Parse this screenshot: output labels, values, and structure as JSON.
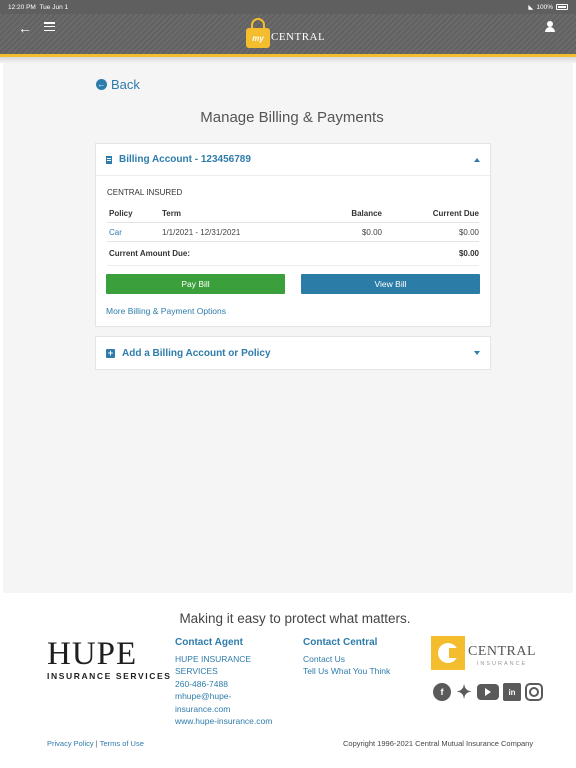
{
  "status_bar": {
    "time": "12:20 PM",
    "date": "Tue Jun 1",
    "battery": "100%"
  },
  "header": {
    "logo_small": "my",
    "logo_text": "CENTRAL"
  },
  "nav": {
    "back_label": "Back"
  },
  "page": {
    "title": "Manage Billing & Payments"
  },
  "billing_account": {
    "header": "Billing Account - 123456789",
    "insured_name": "CENTRAL INSURED",
    "columns": [
      "Policy",
      "Term",
      "Balance",
      "Current Due"
    ],
    "rows": [
      {
        "policy": "Car",
        "term": "1/1/2021 - 12/31/2021",
        "balance": "$0.00",
        "current_due": "$0.00"
      }
    ],
    "total_label": "Current Amount Due:",
    "total_value": "$0.00",
    "pay_button": "Pay Bill",
    "view_button": "View Bill",
    "more_options": "More Billing & Payment Options"
  },
  "add_account": {
    "header": "Add a Billing Account or Policy"
  },
  "footer": {
    "tagline": "Making it easy to protect what matters.",
    "agency_logo_big": "HUPE",
    "agency_logo_small": "INSURANCE SERVICES",
    "contact_agent": {
      "heading": "Contact Agent",
      "name_line1": "HUPE INSURANCE",
      "name_line2": "SERVICES",
      "phone": "260-486-7488",
      "email_line1": "mhupe@hupe-",
      "email_line2": "insurance.com",
      "website": "www.hupe-insurance.com"
    },
    "contact_central": {
      "heading": "Contact Central",
      "contact_us": "Contact Us",
      "feedback": "Tell Us What You Think"
    },
    "central_logo": {
      "name": "CENTRAL",
      "sub": "INSURANCE"
    },
    "social": {
      "linkedin": "in"
    },
    "privacy": "Privacy Policy",
    "separator": "|",
    "terms": "Terms of Use",
    "copyright": "Copyright 1996-2021 Central Mutual Insurance Company"
  },
  "colors": {
    "brand_yellow": "#f3bd2e",
    "link_blue": "#2e7cab",
    "pay_green": "#3ba03b",
    "view_blue": "#2c7ca8"
  }
}
